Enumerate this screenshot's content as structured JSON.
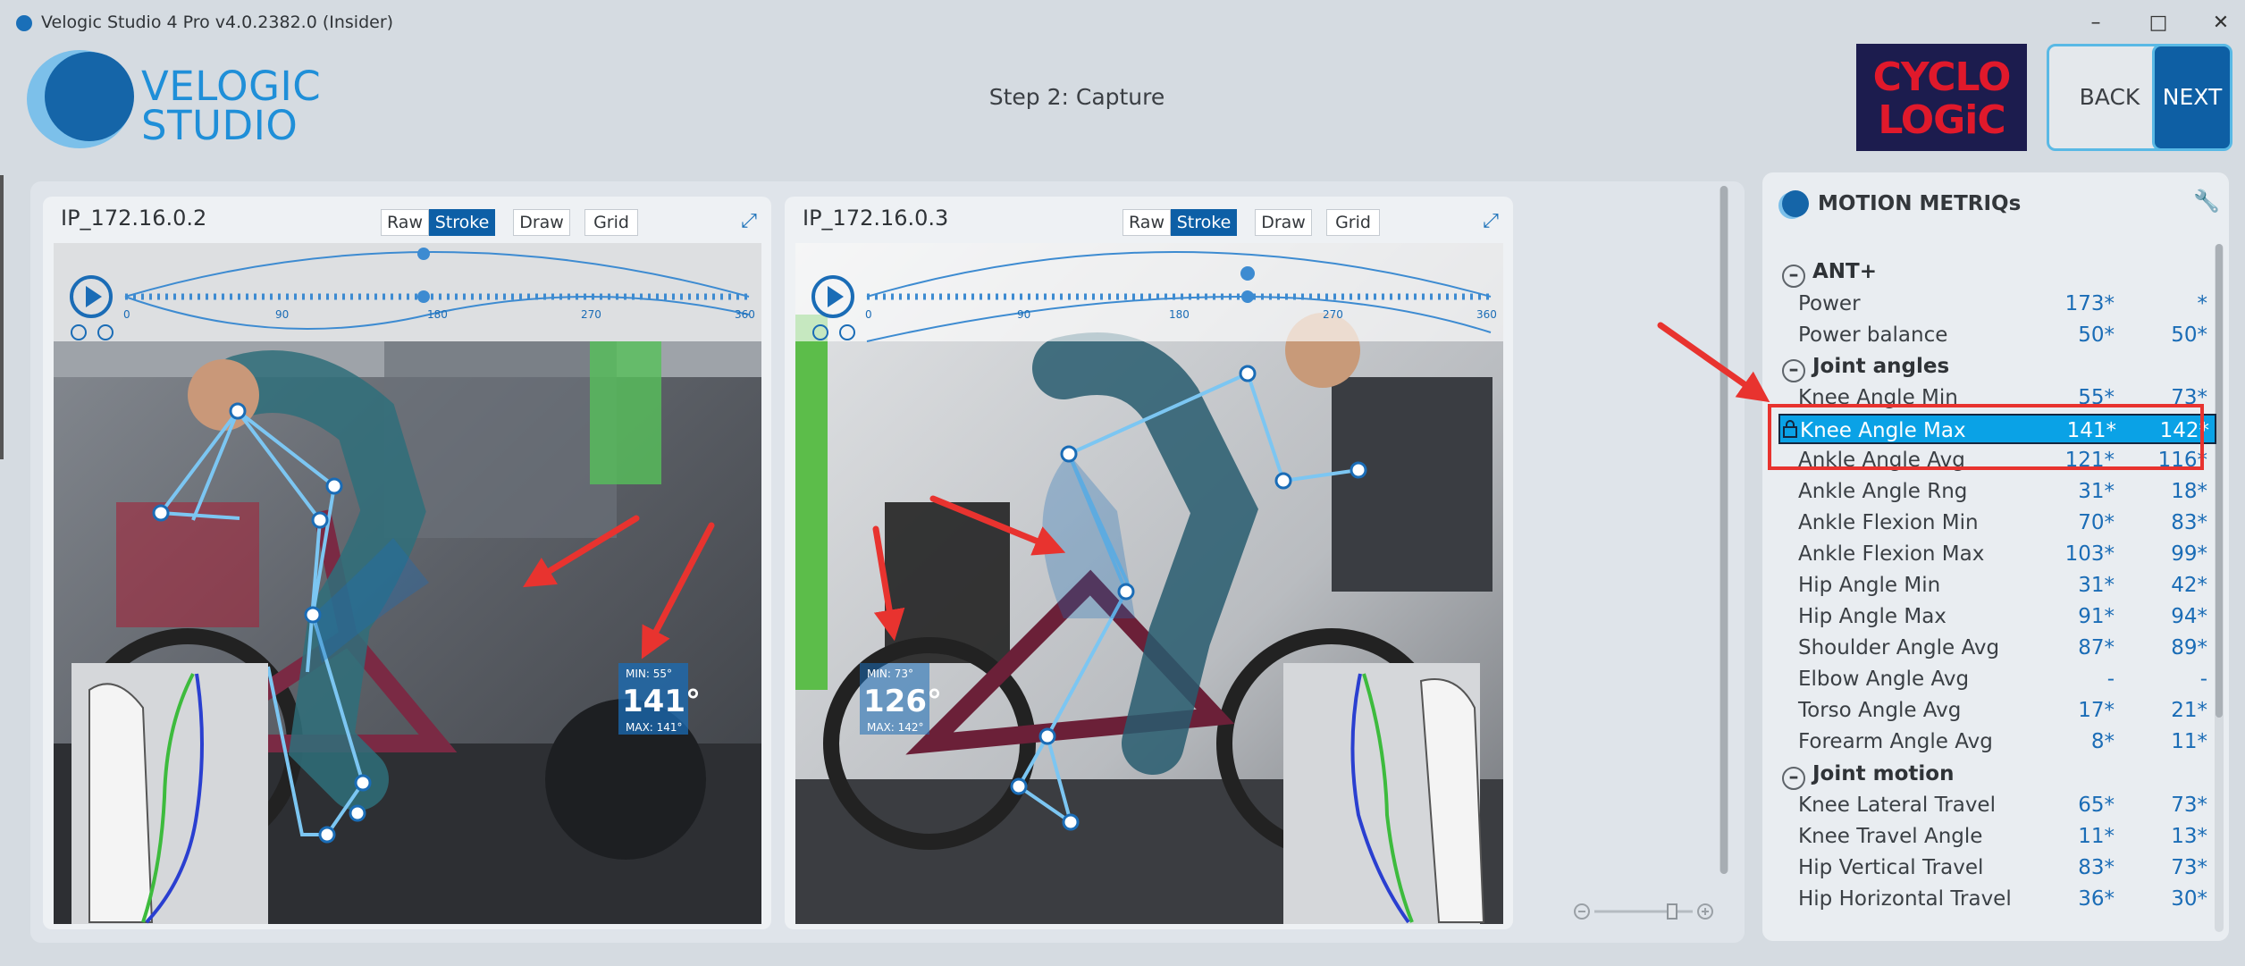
{
  "window": {
    "title": "Velogic Studio 4 Pro v4.0.2382.0 (Insider)"
  },
  "header": {
    "logo_line1": "VELOGIC",
    "logo_line2": "STUDIO",
    "step_title": "Step 2: Capture",
    "partner_line1": "CYCLO",
    "partner_line2": "LOGiC",
    "back_label": "BACK",
    "next_label": "NEXT"
  },
  "cameras": [
    {
      "title": "IP_172.16.0.2",
      "toggles": [
        "Raw",
        "Stroke",
        "Draw",
        "Grid"
      ],
      "active_toggle": "Stroke",
      "timeline_ticks": [
        "0",
        "90",
        "180",
        "270",
        "360"
      ],
      "angle_min": "MIN: 55°",
      "angle_value": "141°",
      "angle_max": "MAX: 141°"
    },
    {
      "title": "IP_172.16.0.3",
      "toggles": [
        "Raw",
        "Stroke",
        "Draw",
        "Grid"
      ],
      "active_toggle": "Stroke",
      "timeline_ticks": [
        "0",
        "90",
        "180",
        "270",
        "360"
      ],
      "angle_min": "MIN: 73°",
      "angle_value": "126°",
      "angle_max": "MAX: 142°"
    }
  ],
  "metrics": {
    "title": "MOTION METRIQs",
    "sections": [
      {
        "name": "ANT+",
        "rows": [
          {
            "label": "Power",
            "v1": "173*",
            "v2": "*"
          },
          {
            "label": "Power balance",
            "v1": "50*",
            "v2": "50*"
          }
        ]
      },
      {
        "name": "Joint angles",
        "rows": [
          {
            "label": "Knee Angle Min",
            "v1": "55*",
            "v2": "73*"
          },
          {
            "label": "Knee Angle Max",
            "v1": "141*",
            "v2": "142*",
            "selected": true
          },
          {
            "label": "Ankle Angle Avg",
            "v1": "121*",
            "v2": "116*"
          },
          {
            "label": "Ankle Angle Rng",
            "v1": "31*",
            "v2": "18*"
          },
          {
            "label": "Ankle Flexion Min",
            "v1": "70*",
            "v2": "83*"
          },
          {
            "label": "Ankle Flexion Max",
            "v1": "103*",
            "v2": "99*"
          },
          {
            "label": "Hip Angle Min",
            "v1": "31*",
            "v2": "42*"
          },
          {
            "label": "Hip Angle Max",
            "v1": "91*",
            "v2": "94*"
          },
          {
            "label": "Shoulder Angle Avg",
            "v1": "87*",
            "v2": "89*"
          },
          {
            "label": "Elbow Angle Avg",
            "v1": "-",
            "v2": "-"
          },
          {
            "label": "Torso Angle Avg",
            "v1": "17*",
            "v2": "21*"
          },
          {
            "label": "Forearm Angle Avg",
            "v1": "8*",
            "v2": "11*"
          }
        ]
      },
      {
        "name": "Joint motion",
        "rows": [
          {
            "label": "Knee Lateral Travel",
            "v1": "65*",
            "v2": "73*"
          },
          {
            "label": "Knee Travel Angle",
            "v1": "11*",
            "v2": "13*"
          },
          {
            "label": "Hip Vertical Travel",
            "v1": "83*",
            "v2": "73*"
          },
          {
            "label": "Hip Horizontal Travel",
            "v1": "36*",
            "v2": "30*"
          }
        ]
      }
    ]
  },
  "colors": {
    "accent": "#0d5fa6",
    "selection": "#0aa2e6",
    "annotation_arrow": "#e8332f",
    "annotation_box": "#e8332f",
    "skeleton": "#7cc6f2"
  }
}
